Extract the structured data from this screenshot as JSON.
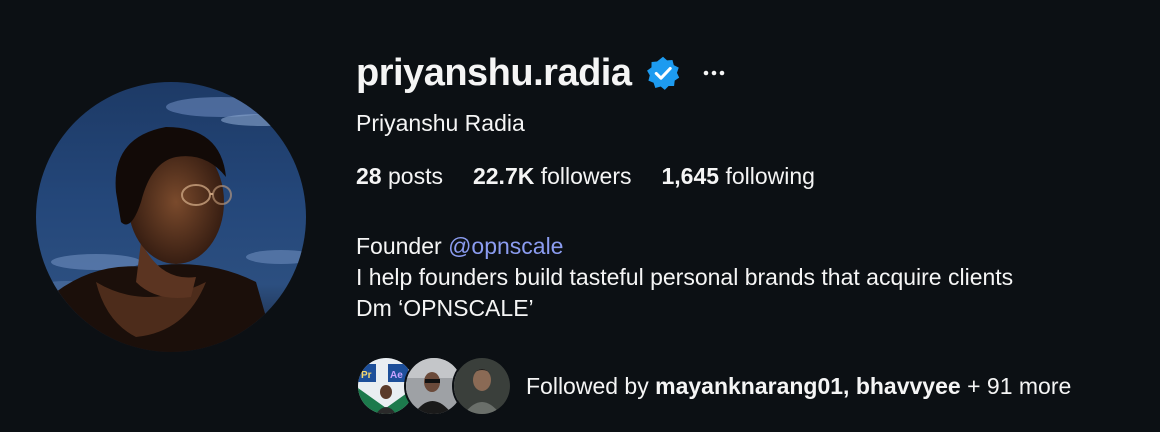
{
  "profile": {
    "username": "priyanshu.radia",
    "full_name": "Priyanshu Radia",
    "verified": true,
    "avatar_icon": "profile-photo"
  },
  "stats": {
    "posts_count": "28",
    "posts_label": " posts",
    "followers_count": "22.7K",
    "followers_label": " followers",
    "following_count": "1,645",
    "following_label": " following"
  },
  "bio": {
    "line1_prefix": "Founder ",
    "mention": "@opnscale",
    "line2": "I help founders build tasteful personal brands that acquire clients",
    "line3": "Dm ‘OPNSCALE’"
  },
  "followed_by": {
    "prefix": "Followed by ",
    "names": "mayanknarang01, bhavvyee",
    "suffix": " + 91 more"
  },
  "colors": {
    "background": "#0c1014",
    "text": "#f5f5f5",
    "mention": "#8b9cf0",
    "verified": "#1d9bf0"
  }
}
